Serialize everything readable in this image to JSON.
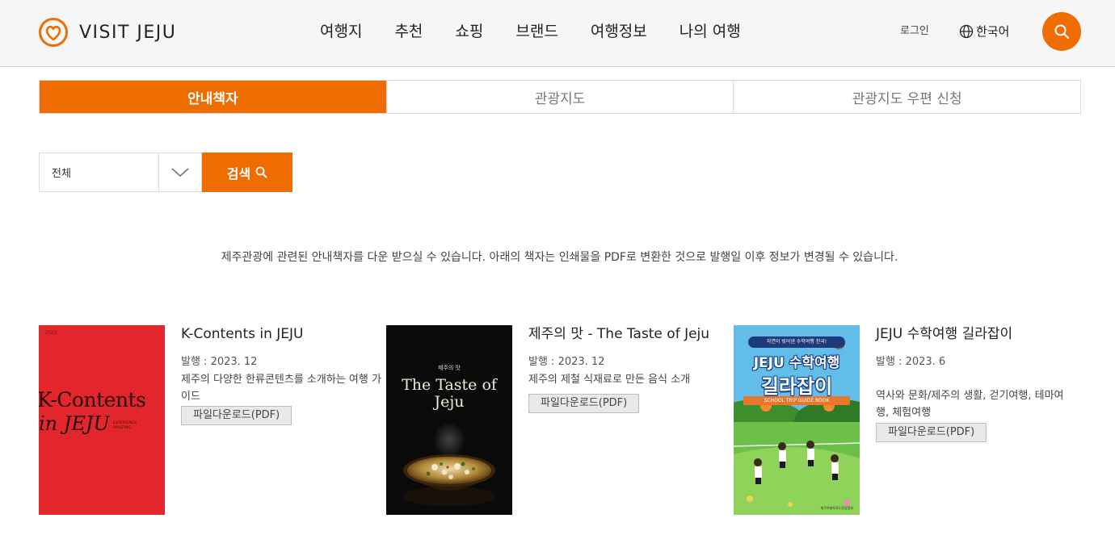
{
  "header": {
    "logo_text": "VISIT JEJU",
    "nav": [
      "여행지",
      "추천",
      "쇼핑",
      "브랜드",
      "여행정보",
      "나의 여행"
    ],
    "login_label": "로그인",
    "language_label": "한국어",
    "brand_color": "#ef6c00"
  },
  "tabs": [
    {
      "label": "안내책자",
      "active": true
    },
    {
      "label": "관광지도",
      "active": false
    },
    {
      "label": "관광지도 우편 신청",
      "active": false
    }
  ],
  "filter": {
    "selected": "전체",
    "search_label": "검색"
  },
  "notice": "제주관광에 관련된 안내책자를 다운 받으실 수 있습니다. 아래의 책자는 인쇄물을 PDF로 변환한 것으로 발행일 이후 정보가 변경될 수 있습니다.",
  "books": [
    {
      "title": "K-Contents in JEJU",
      "date": "발행 : 2023. 12",
      "description": "제주의 다양한 한류콘텐츠를 소개하는 여행 가이드",
      "download_label": "파일다운로드(PDF)",
      "cover": {
        "year": "2023",
        "line1": "K-Contents",
        "line2": "in JEJU",
        "tagline": "EXPERIENCE AMAZING"
      }
    },
    {
      "title": "제주의 맛 - The Taste of Jeju",
      "date": "발행 : 2023. 12",
      "description": "제주의 제철 식재료로 만든 음식 소개",
      "download_label": "파일다운로드(PDF)",
      "cover": {
        "small": "제주의 맛",
        "line1": "The Taste of",
        "line2": "Jeju"
      }
    },
    {
      "title": "JEJU 수학여행 길라잡이",
      "date": "발행 : 2023. 6",
      "description": "역사와 문화/제주의 생활, 걷기여행, 테마여행, 체험여행",
      "download_label": "파일다운로드(PDF)",
      "cover": {
        "banner": "자연이 빚어낸 수학여행 천국!",
        "line1": "JEJU 수학여행",
        "line2": "길라잡이",
        "sub": "SCHOOL TRIP GUIDE BOOK",
        "footer": "제주특별자치도관광협회"
      }
    }
  ]
}
